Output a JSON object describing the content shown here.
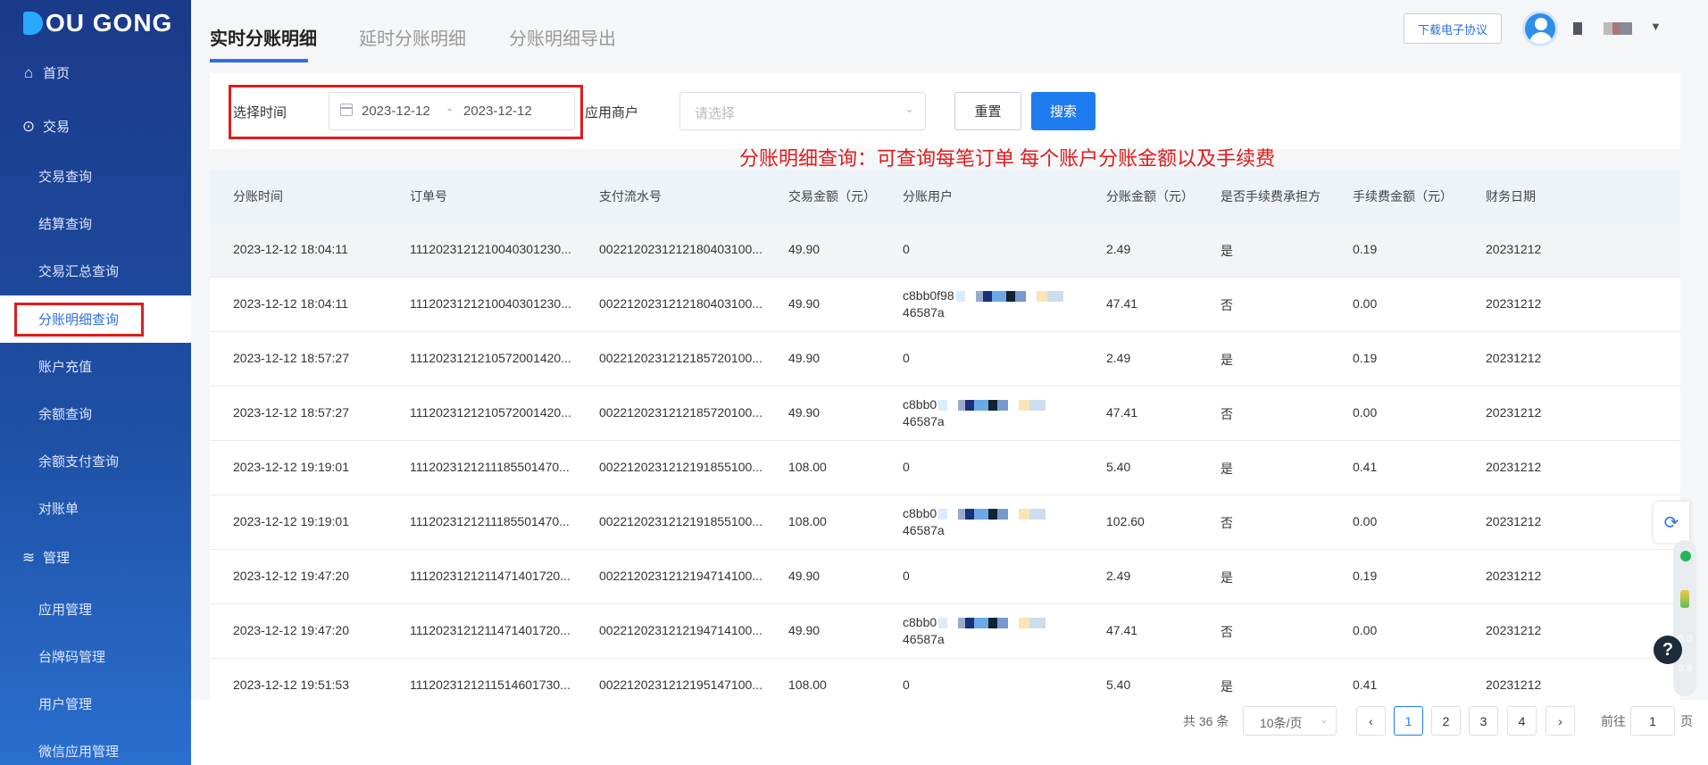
{
  "brand": {
    "logo_text": "OU GONG"
  },
  "sidebar": {
    "items": [
      {
        "label": "首页",
        "icon": "home-icon"
      },
      {
        "label": "交易",
        "icon": "coin-icon"
      },
      {
        "label": "交易查询"
      },
      {
        "label": "结算查询"
      },
      {
        "label": "交易汇总查询"
      },
      {
        "label": "分账明细查询"
      },
      {
        "label": "账户充值"
      },
      {
        "label": "余额查询"
      },
      {
        "label": "余额支付查询"
      },
      {
        "label": "对账单"
      },
      {
        "label": "管理",
        "icon": "layers-icon"
      },
      {
        "label": "应用管理"
      },
      {
        "label": "台牌码管理"
      },
      {
        "label": "用户管理"
      },
      {
        "label": "微信应用管理"
      }
    ]
  },
  "header": {
    "tabs": [
      {
        "label": "实时分账明细"
      },
      {
        "label": "延时分账明细"
      },
      {
        "label": "分账明细导出"
      }
    ],
    "download_label": "下载电子协议"
  },
  "filter": {
    "time_label": "选择时间",
    "date_start": "2023-12-12",
    "date_sep": "-",
    "date_end": "2023-12-12",
    "merchant_label": "应用商户",
    "merchant_placeholder": "请选择",
    "reset_label": "重置",
    "search_label": "搜索"
  },
  "annotation": "分账明细查询：可查询每笔订单 每个账户分账金额以及手续费",
  "table": {
    "headers": [
      "分账时间",
      "订单号",
      "支付流水号",
      "交易金额（元）",
      "分账用户",
      "分账金额（元）",
      "是否手续费承担方",
      "手续费金额（元）",
      "财务日期"
    ],
    "rows": [
      [
        "2023-12-12 18:04:11",
        "1112023121210040301230...",
        "0022120231212180403100...",
        "49.90",
        "0",
        "",
        "2.49",
        "是",
        "0.19",
        "20231212"
      ],
      [
        "2023-12-12 18:04:11",
        "1112023121210040301230...",
        "0022120231212180403100...",
        "49.90",
        "c8bb0f98",
        "46587a",
        "47.41",
        "否",
        "0.00",
        "20231212"
      ],
      [
        "2023-12-12 18:57:27",
        "1112023121210572001420...",
        "0022120231212185720100...",
        "49.90",
        "0",
        "",
        "2.49",
        "是",
        "0.19",
        "20231212"
      ],
      [
        "2023-12-12 18:57:27",
        "1112023121210572001420...",
        "0022120231212185720100...",
        "49.90",
        "c8bb0",
        "46587a",
        "47.41",
        "否",
        "0.00",
        "20231212"
      ],
      [
        "2023-12-12 19:19:01",
        "1112023121211185501470...",
        "0022120231212191855100...",
        "108.00",
        "0",
        "",
        "5.40",
        "是",
        "0.41",
        "20231212"
      ],
      [
        "2023-12-12 19:19:01",
        "1112023121211185501470...",
        "0022120231212191855100...",
        "108.00",
        "c8bb0",
        "46587a",
        "102.60",
        "否",
        "0.00",
        "20231212"
      ],
      [
        "2023-12-12 19:47:20",
        "1112023121211471401720...",
        "0022120231212194714100...",
        "49.90",
        "0",
        "",
        "2.49",
        "是",
        "0.19",
        "20231212"
      ],
      [
        "2023-12-12 19:47:20",
        "1112023121211471401720...",
        "0022120231212194714100...",
        "49.90",
        "c8bb0",
        "46587a",
        "47.41",
        "否",
        "0.00",
        "20231212"
      ],
      [
        "2023-12-12 19:51:53",
        "1112023121211514601730...",
        "0022120231212195147100...",
        "108.00",
        "0",
        "",
        "5.40",
        "是",
        "0.41",
        "20231212"
      ]
    ]
  },
  "pagination": {
    "total": "共 36 条",
    "page_size": "10条/页",
    "pages": [
      "1",
      "2",
      "3",
      "4"
    ],
    "current": "1",
    "goto_label": "前往",
    "goto_value": "1",
    "goto_suffix": "页"
  },
  "widgets": {
    "help": "?",
    "up_speed": "0.0",
    "down_speed": "3.8"
  }
}
